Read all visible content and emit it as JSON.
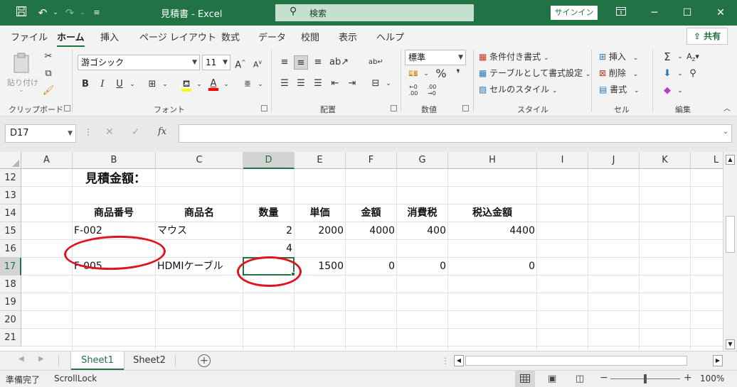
{
  "titlebar": {
    "title": "見積書 - Excel",
    "search_placeholder": "検索",
    "signin_label": "サインイン"
  },
  "menu": {
    "tabs": [
      "ファイル",
      "ホーム",
      "挿入",
      "ページ レイアウト",
      "数式",
      "データ",
      "校閲",
      "表示",
      "ヘルプ"
    ],
    "active_tab": "ホーム",
    "share_label": "共有"
  },
  "ribbon": {
    "clipboard": {
      "paste_label": "貼り付け",
      "group_label": "クリップボード"
    },
    "font": {
      "font_name": "游ゴシック",
      "font_size": "11",
      "group_label": "フォント",
      "bold": "B",
      "italic": "I",
      "underline": "U"
    },
    "alignment": {
      "group_label": "配置"
    },
    "number": {
      "format": "標準",
      "group_label": "数値",
      "percent": "%",
      "comma": "❜"
    },
    "styles": {
      "conditional": "条件付き書式",
      "table": "テーブルとして書式設定",
      "cell_style": "セルのスタイル",
      "group_label": "スタイル"
    },
    "cells": {
      "insert": "挿入",
      "delete": "削除",
      "format": "書式",
      "group_label": "セル"
    },
    "editing": {
      "group_label": "編集"
    }
  },
  "formula_bar": {
    "name_box": "D17",
    "fx_label": "fx",
    "formula": ""
  },
  "grid": {
    "columns": [
      "A",
      "B",
      "C",
      "D",
      "E",
      "F",
      "G",
      "H",
      "I",
      "J",
      "K",
      "L"
    ],
    "selected_column": "D",
    "rows": [
      "12",
      "13",
      "14",
      "15",
      "16",
      "17",
      "18",
      "19",
      "20",
      "21"
    ],
    "selected_row": "17",
    "cells": {
      "B12": "見積金額：",
      "B14": "商品番号",
      "C14": "商品名",
      "D14": "数量",
      "E14": "単価",
      "F14": "金額",
      "G14": "消費税",
      "H14": "税込金額",
      "B15": "F-002",
      "C15": "マウス",
      "D15": "2",
      "E15": "2000",
      "F15": "4000",
      "G15": "400",
      "H15": "4400",
      "D16": "4",
      "B17": "F-005",
      "C17": "HDMIケーブル",
      "E17": "1500",
      "F17": "0",
      "G17": "0",
      "H17": "0"
    },
    "annotation_color": "#e0141e"
  },
  "sheets": {
    "tabs": [
      "Sheet1",
      "Sheet2"
    ],
    "active": "Sheet1",
    "add_label": "+"
  },
  "status": {
    "ready": "準備完了",
    "scroll_lock": "ScrollLock",
    "zoom": "100%"
  },
  "colors": {
    "excel_green": "#217346",
    "annotation_red": "#e0141e"
  }
}
